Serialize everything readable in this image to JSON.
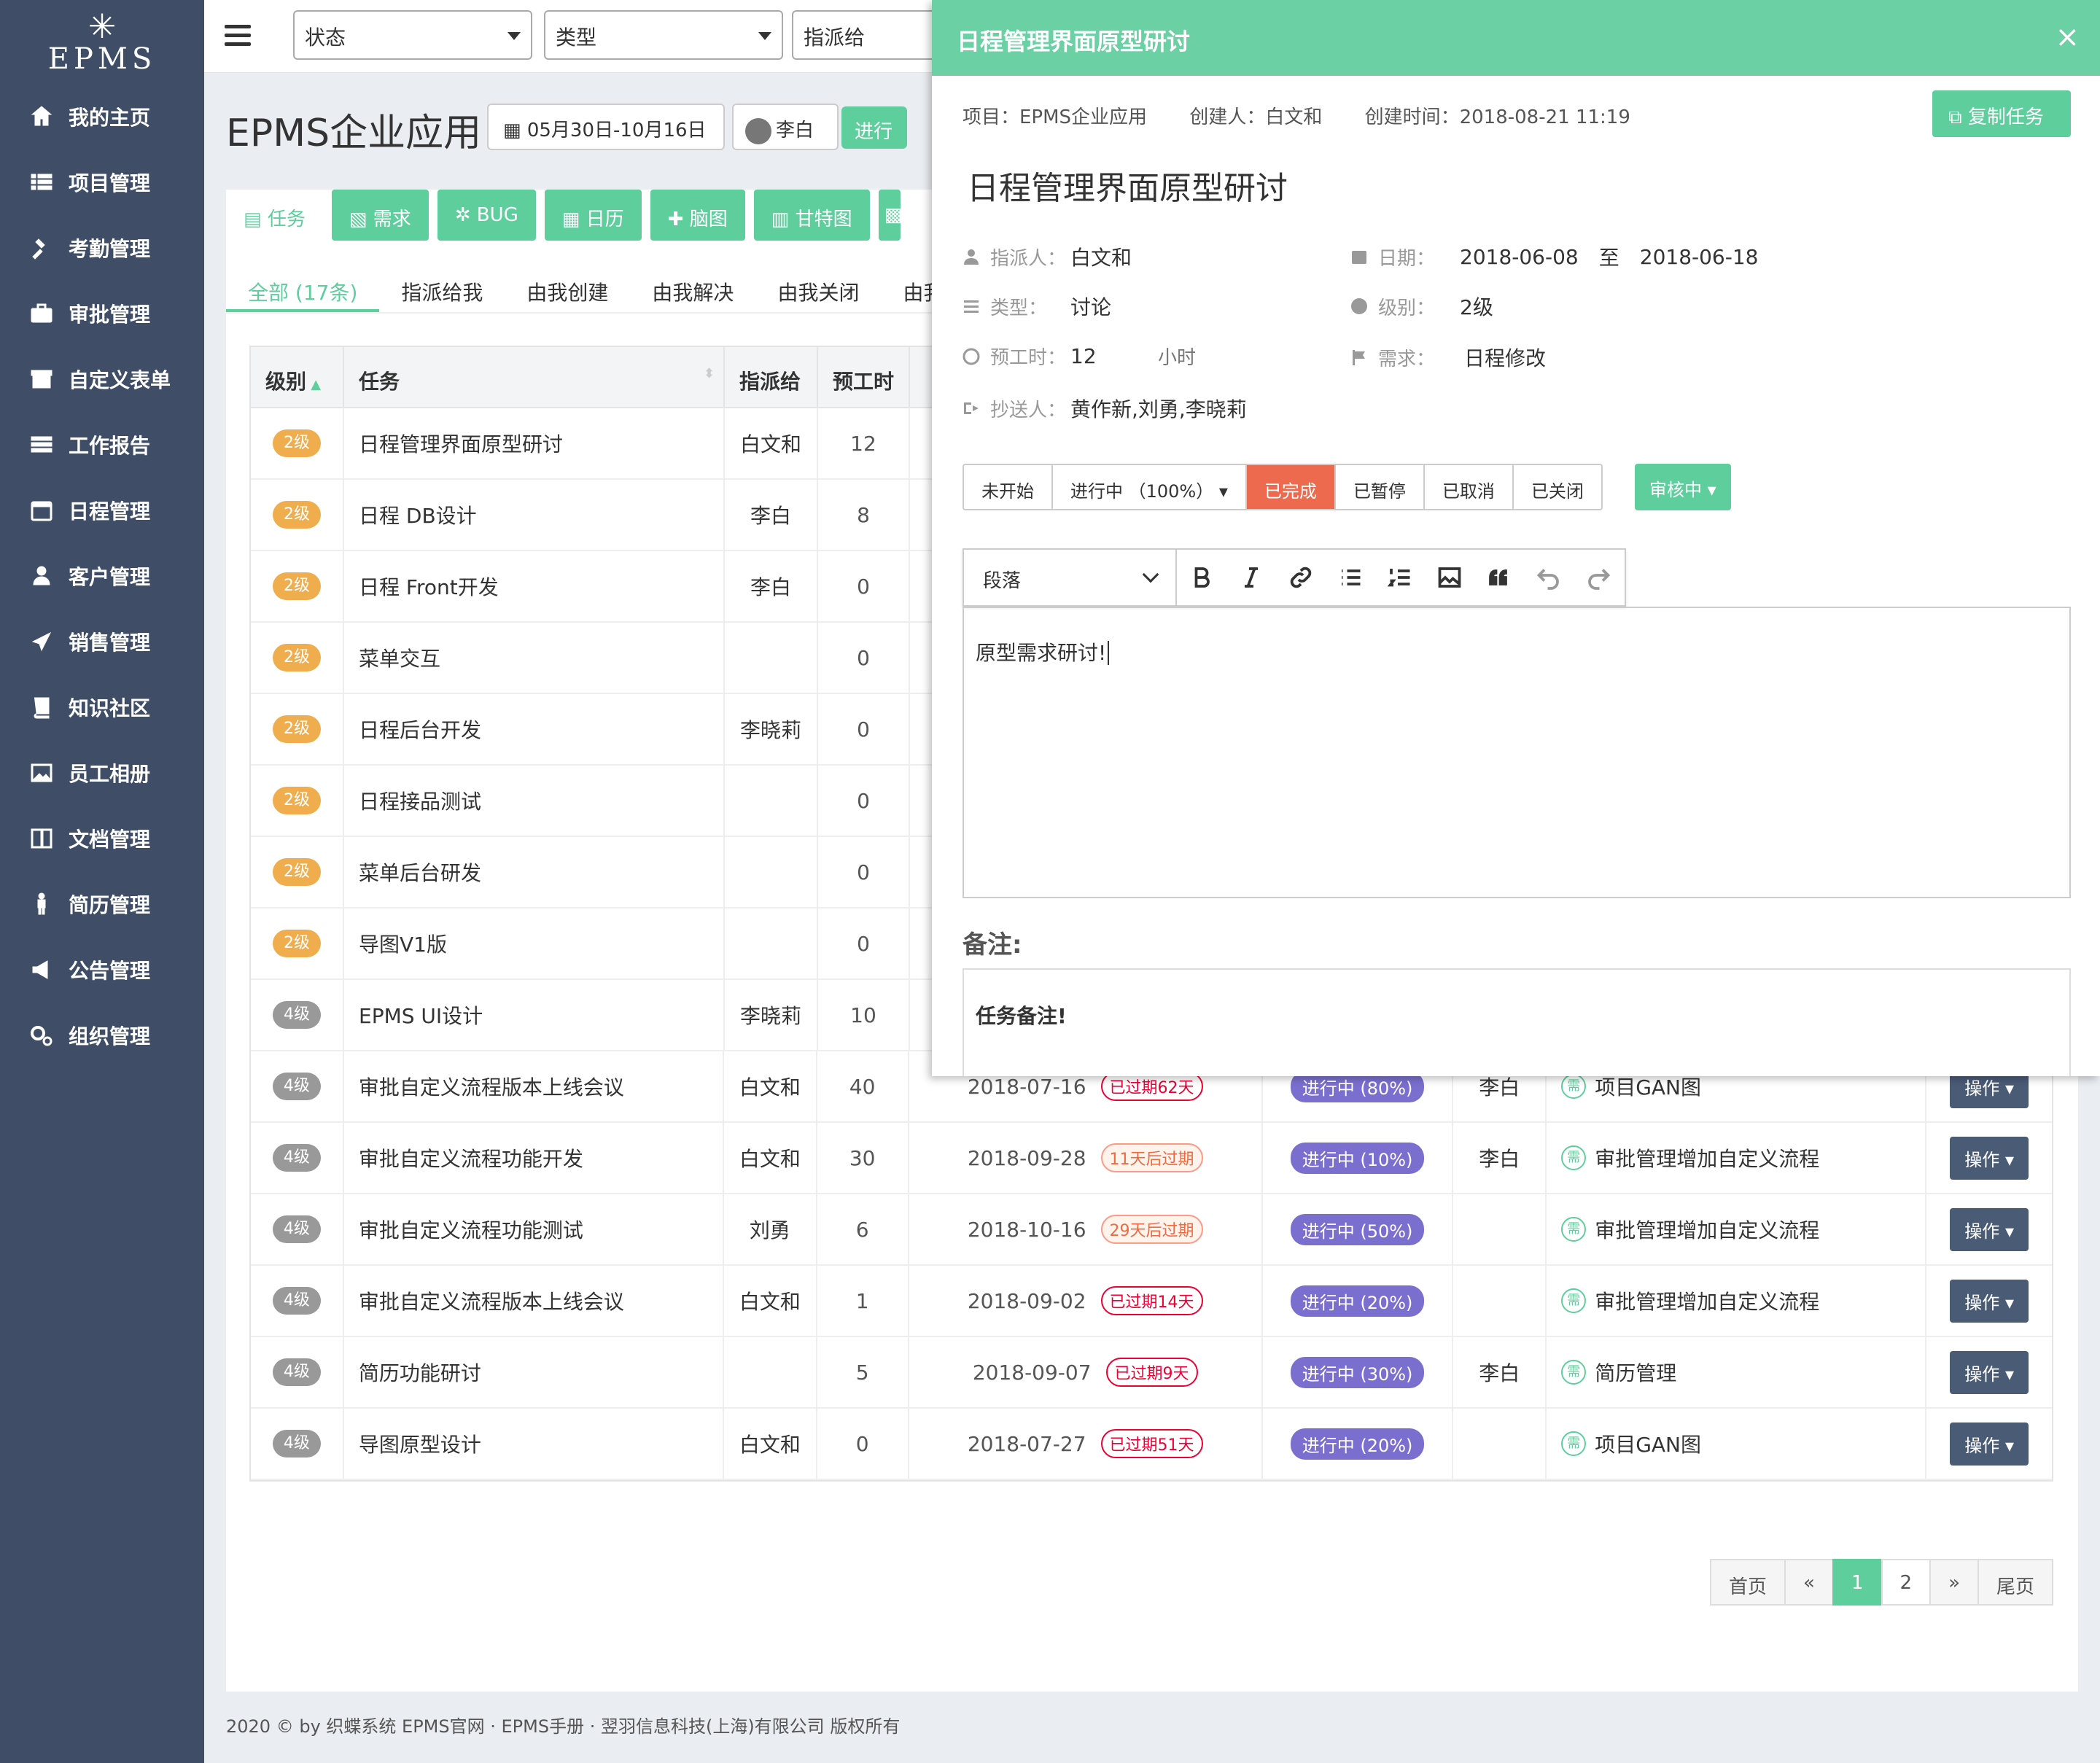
{
  "app": {
    "logo_text": "EPMS"
  },
  "sidebar": {
    "items": [
      {
        "label": "我的主页",
        "icon": "home-icon"
      },
      {
        "label": "项目管理",
        "icon": "list-icon"
      },
      {
        "label": "考勤管理",
        "icon": "gavel-icon"
      },
      {
        "label": "审批管理",
        "icon": "briefcase-icon"
      },
      {
        "label": "自定义表单",
        "icon": "archive-icon"
      },
      {
        "label": "工作报告",
        "icon": "tasks-icon"
      },
      {
        "label": "日程管理",
        "icon": "calendar-icon"
      },
      {
        "label": "客户管理",
        "icon": "users-icon"
      },
      {
        "label": "销售管理",
        "icon": "plane-icon"
      },
      {
        "label": "知识社区",
        "icon": "book-icon"
      },
      {
        "label": "员工相册",
        "icon": "image-icon"
      },
      {
        "label": "文档管理",
        "icon": "columns-icon"
      },
      {
        "label": "简历管理",
        "icon": "person-icon"
      },
      {
        "label": "公告管理",
        "icon": "bullhorn-icon"
      },
      {
        "label": "组织管理",
        "icon": "cogs-icon"
      }
    ]
  },
  "topbar": {
    "filters": [
      "状态",
      "类型",
      "指派给"
    ]
  },
  "project": {
    "title": "EPMS企业应用",
    "date_range": "05月30日-10月16日",
    "user": "李白",
    "status": "进行"
  },
  "tool_tabs": [
    "任务",
    "需求",
    "BUG",
    "日历",
    "脑图",
    "甘特图"
  ],
  "sub_tabs": [
    "全部 (17条)",
    "指派给我",
    "由我创建",
    "由我解决",
    "由我关闭",
    "由我"
  ],
  "table": {
    "headers": [
      "级别",
      "任务",
      "指派给",
      "预工时"
    ],
    "rows": [
      {
        "level": "2级",
        "task": "日程管理界面原型研讨",
        "assignee": "白文和",
        "hours": "12"
      },
      {
        "level": "2级",
        "task": "日程 DB设计",
        "assignee": "李白",
        "hours": "8"
      },
      {
        "level": "2级",
        "task": "日程 Front开发",
        "assignee": "李白",
        "hours": "0"
      },
      {
        "level": "2级",
        "task": "菜单交互",
        "assignee": "",
        "hours": "0"
      },
      {
        "level": "2级",
        "task": "日程后台开发",
        "assignee": "李晓莉",
        "hours": "0"
      },
      {
        "level": "2级",
        "task": "日程接品测试",
        "assignee": "",
        "hours": "0"
      },
      {
        "level": "2级",
        "task": "菜单后台研发",
        "assignee": "",
        "hours": "0"
      },
      {
        "level": "2级",
        "task": "导图V1版",
        "assignee": "",
        "hours": "0"
      },
      {
        "level": "4级",
        "task": "EPMS UI设计",
        "assignee": "李晓莉",
        "hours": "10"
      },
      {
        "level": "4级",
        "task": "审批自定义流程版本上线会议",
        "assignee": "白文和",
        "hours": "40",
        "date": "2018-07-16",
        "due": "已过期62天",
        "due_type": "overdue",
        "progress": "进行中 (80%)",
        "closer": "李白",
        "need": "项目GAN图",
        "op": "操作"
      },
      {
        "level": "4级",
        "task": "审批自定义流程功能开发",
        "assignee": "白文和",
        "hours": "30",
        "date": "2018-09-28",
        "due": "11天后过期",
        "due_type": "soon",
        "progress": "进行中 (10%)",
        "closer": "李白",
        "need": "审批管理增加自定义流程",
        "op": "操作"
      },
      {
        "level": "4级",
        "task": "审批自定义流程功能测试",
        "assignee": "刘勇",
        "hours": "6",
        "date": "2018-10-16",
        "due": "29天后过期",
        "due_type": "soon",
        "progress": "进行中 (50%)",
        "closer": "",
        "need": "审批管理增加自定义流程",
        "op": "操作"
      },
      {
        "level": "4级",
        "task": "审批自定义流程版本上线会议",
        "assignee": "白文和",
        "hours": "1",
        "date": "2018-09-02",
        "due": "已过期14天",
        "due_type": "overdue",
        "progress": "进行中 (20%)",
        "closer": "",
        "need": "审批管理增加自定义流程",
        "op": "操作"
      },
      {
        "level": "4级",
        "task": "简历功能研讨",
        "assignee": "",
        "hours": "5",
        "date": "2018-09-07",
        "due": "已过期9天",
        "due_type": "overdue",
        "progress": "进行中 (30%)",
        "closer": "李白",
        "need": "简历管理",
        "op": "操作"
      },
      {
        "level": "4级",
        "task": "导图原型设计",
        "assignee": "白文和",
        "hours": "0",
        "date": "2018-07-27",
        "due": "已过期51天",
        "due_type": "overdue",
        "progress": "进行中 (20%)",
        "closer": "",
        "need": "项目GAN图",
        "op": "操作"
      }
    ],
    "need_icon_char": "需"
  },
  "pager": {
    "first": "首页",
    "prev": "«",
    "pages": [
      "1",
      "2"
    ],
    "active": "1",
    "next": "»",
    "last": "尾页"
  },
  "footer": "2020 © by 织蝶系统   EPMS官网 · EPMS手册 · 翌羽信息科技(上海)有限公司 版权所有",
  "drawer": {
    "header": "日程管理界面原型研讨",
    "close": "×",
    "project": "项目：EPMS企业应用",
    "creator": "创建人：白文和",
    "created": "创建时间：2018-08-21 11:19",
    "copy_button": "复制任务",
    "title": "日程管理界面原型研讨",
    "fields": {
      "assignee_label": "指派人：",
      "assignee": "白文和",
      "date_label": "日期：",
      "date_start": "2018-06-08",
      "date_to": "至",
      "date_end": "2018-06-18",
      "type_label": "类型：",
      "type": "讨论",
      "level_label": "级别：",
      "level": "2级",
      "hours_label": "预工时：",
      "hours": "12",
      "hours_unit": "小时",
      "need_label": "需求：",
      "need": "日程修改",
      "cc_label": "抄送人：",
      "cc": "黄作新,刘勇,李晓莉"
    },
    "status_buttons": [
      "未开始",
      "进行中 （100%）",
      "已完成",
      "已暂停",
      "已取消",
      "已关闭"
    ],
    "status_active": "已完成",
    "review_button": "审核中",
    "editor": {
      "paragraph": "段落",
      "content": "原型需求研讨!"
    },
    "notes_label": "备注:",
    "notes": "任务备注!"
  },
  "colors": {
    "accent": "#5ecf9c",
    "sidebar": "#3f4d67",
    "danger": "#ee6a4e",
    "progress": "#7a6fcf"
  }
}
